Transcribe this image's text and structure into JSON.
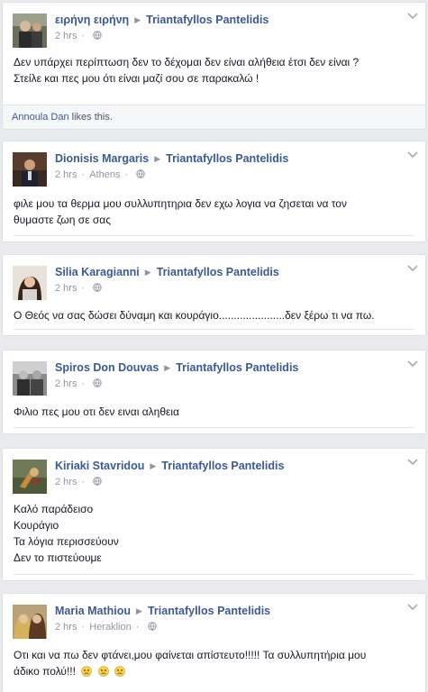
{
  "posts": [
    {
      "author": "ειρήνη ειρήνη",
      "target": "Triantafyllos Pantelidis",
      "time": "2 hrs",
      "location": "",
      "lines": [
        "Δεν υπάρχει περίπτωση δεν το δέχομαι δεν είναι αλήθεια έτσι δεν είναι ?",
        "Στείλε και πες μου ότι είναι μαζί σου σε παρακαλώ !"
      ],
      "liker": "Annoula Dan",
      "likes_suffix": " likes this."
    },
    {
      "author": "Dionisis Margaris",
      "target": "Triantafyllos Pantelidis",
      "time": "2 hrs",
      "location": "Athens",
      "lines": [
        "φιλε μου τα θερμα μου συλλυπητηρια δεν εχω λογια να ζησεται να τον",
        "θυμαστε ζωη σε σας"
      ]
    },
    {
      "author": "Silia Karagianni",
      "target": "Triantafyllos Pantelidis",
      "time": "2 hrs",
      "location": "",
      "lines": [
        "Ο Θεός να σας δώσει δύναμη και κουράγιο......................δεν ξέρω τι να πω."
      ]
    },
    {
      "author": "Spiros Don Douvas",
      "target": "Triantafyllos Pantelidis",
      "time": "2 hrs",
      "location": "",
      "lines": [
        "Φιλιο πες μου οτι δεν ειναι αληθεια"
      ]
    },
    {
      "author": "Kiriaki Stavridou",
      "target": "Triantafyllos Pantelidis",
      "time": "2 hrs",
      "location": "",
      "lines": [
        "Καλό παράδεισο",
        "Κουράγιο",
        "Τα λόγια περισσεύουν",
        "Δεν το πιστεύουμε"
      ]
    },
    {
      "author": "Maria Mathiou",
      "target": "Triantafyllos Pantelidis",
      "time": "2 hrs",
      "location": "Heraklion",
      "lines": [
        "Οτι και να πω δεν φτάνει,μου φαίνεται απίστευτο!!!!! Τα συλλυπητήρια μου",
        "άδικο πολύ!!!"
      ]
    }
  ],
  "colors": {
    "link": "#3b5998",
    "meta": "#9197a3",
    "background": "#e9eaed"
  },
  "icons": {
    "privacy": "globe-icon",
    "menu": "chevron-down-icon",
    "reaction": "sad-emoji-icon"
  }
}
